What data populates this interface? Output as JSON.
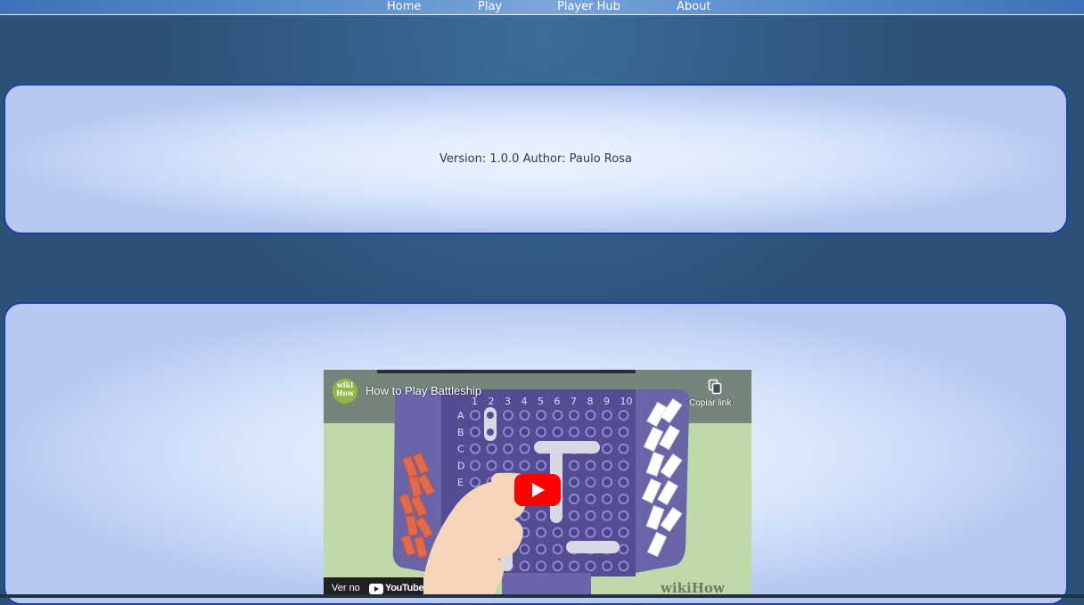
{
  "nav": {
    "items": [
      {
        "label": "Home"
      },
      {
        "label": "Play"
      },
      {
        "label": "Player Hub"
      },
      {
        "label": "About"
      }
    ]
  },
  "info": {
    "version_text": "Version: 1.0.0 Author: Paulo Rosa"
  },
  "video": {
    "title": "How to Play Battleship",
    "channel_logo_text": "wiki How",
    "copy_link_label": "Copiar link",
    "watch_on_label": "Ver no",
    "youtube_label": "YouTube",
    "watermark": "wikiHow",
    "board_columns": [
      "1",
      "2",
      "3",
      "4",
      "5",
      "6",
      "7",
      "8",
      "9",
      "10"
    ],
    "board_rows": [
      "A",
      "B",
      "C",
      "D",
      "E"
    ]
  },
  "colors": {
    "page_bg": "#2c5278",
    "panel_border": "#1b3ea8",
    "youtube_red": "#ff0000"
  }
}
